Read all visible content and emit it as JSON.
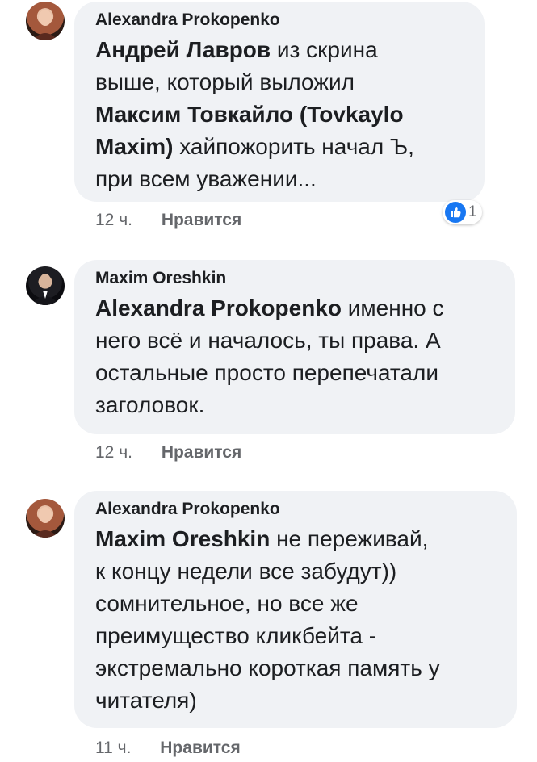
{
  "comments": [
    {
      "author": "Alexandra Prokopenko",
      "mention": "Андрей Лавров",
      "text_after_mention": " из скрина\nвыше, который выложил\n",
      "mention2": "Максим Товкайло (Tovkaylo\nMaxim)",
      "text_end": " хайпожорить начал Ъ,\nпри всем уважении...",
      "time": "12 ч.",
      "like_label": "Нравится",
      "reaction_count": "1"
    },
    {
      "author": "Maxim Oreshkin",
      "mention": "Alexandra Prokopenko",
      "text_after_mention": " именно с\nнего всё и началось, ты права. А\nостальные просто перепечатали\nзаголовок.",
      "time": "12 ч.",
      "like_label": "Нравится"
    },
    {
      "author": "Alexandra Prokopenko",
      "mention": "Maxim Oreshkin",
      "text_after_mention": "  не переживай,\nк концу недели все забудут))\nсомнительное, но все же\nпреимущество кликбейта -\nэкстремально короткая память у\nчитателя)",
      "time": "11 ч.",
      "like_label": "Нравится"
    }
  ],
  "colors": {
    "bubble": "#f0f2f5",
    "meta_text": "#65676b",
    "like_blue": "#1877f2"
  }
}
